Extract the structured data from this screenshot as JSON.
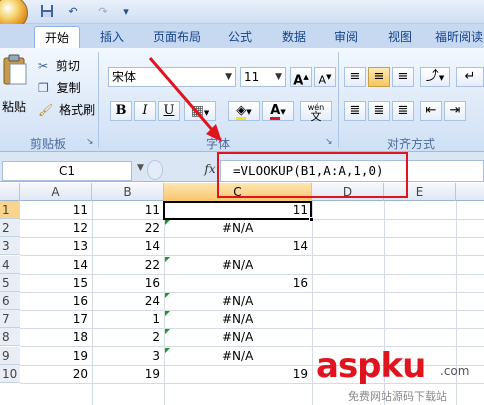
{
  "quick_access": {
    "undo_icon": "↶",
    "redo_icon": "↷"
  },
  "tabs": [
    "开始",
    "插入",
    "页面布局",
    "公式",
    "数据",
    "审阅",
    "视图",
    "福昕阅读"
  ],
  "active_tab": 0,
  "clipboard": {
    "paste_label": "粘贴",
    "cut_label": "剪切",
    "copy_label": "复制",
    "format_painter_label": "格式刷",
    "group_label": "剪贴板"
  },
  "font": {
    "name": "宋体",
    "size": "11",
    "bold": "B",
    "italic": "I",
    "underline": "U",
    "grow": "A",
    "shrink": "A",
    "font_color_glyph": "A",
    "wen": "wén",
    "wen_char": "文",
    "group_label": "字体"
  },
  "alignment": {
    "group_label": "对齐方式"
  },
  "formula_bar": {
    "cell_ref": "C1",
    "fx": "fx",
    "formula": "=VLOOKUP(B1,A:A,1,0)"
  },
  "columns": [
    "A",
    "B",
    "C",
    "D",
    "E"
  ],
  "rows": [
    {
      "n": "1",
      "a": "11",
      "b": "11",
      "c": "11",
      "c_err": ""
    },
    {
      "n": "2",
      "a": "12",
      "b": "22",
      "c": "",
      "c_err": "#N/A"
    },
    {
      "n": "3",
      "a": "13",
      "b": "14",
      "c": "14",
      "c_err": ""
    },
    {
      "n": "4",
      "a": "14",
      "b": "22",
      "c": "",
      "c_err": "#N/A"
    },
    {
      "n": "5",
      "a": "15",
      "b": "16",
      "c": "16",
      "c_err": ""
    },
    {
      "n": "6",
      "a": "16",
      "b": "24",
      "c": "",
      "c_err": "#N/A"
    },
    {
      "n": "7",
      "a": "17",
      "b": "1",
      "c": "",
      "c_err": "#N/A"
    },
    {
      "n": "8",
      "a": "18",
      "b": "2",
      "c": "",
      "c_err": "#N/A"
    },
    {
      "n": "9",
      "a": "19",
      "b": "3",
      "c": "",
      "c_err": "#N/A"
    },
    {
      "n": "10",
      "a": "20",
      "b": "19",
      "c": "19",
      "c_err": ""
    }
  ],
  "watermark": {
    "brand": "aspku",
    "tld": ".com",
    "tagline": "免费网站源码下载站"
  },
  "colors": {
    "accent_red": "#e0141e",
    "error_indicator": "#1a9a2a",
    "selected_header": "#f9c46d"
  }
}
